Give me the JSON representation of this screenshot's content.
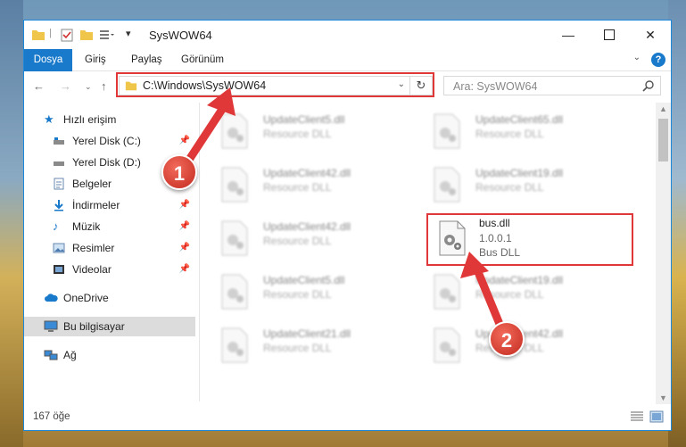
{
  "window": {
    "title": "SysWOW64"
  },
  "ribbon": {
    "tabs": [
      "Dosya",
      "Giriş",
      "Paylaş",
      "Görünüm"
    ],
    "help": "?"
  },
  "address": {
    "path": "C:\\Windows\\SysWOW64"
  },
  "search": {
    "placeholder": "Ara: SysWOW64"
  },
  "sidebar": {
    "quick_access": "Hızlı erişim",
    "items": [
      {
        "label": "Yerel Disk (C:)",
        "icon": "drive-icon"
      },
      {
        "label": "Yerel Disk (D:)",
        "icon": "drive-icon"
      },
      {
        "label": "Belgeler",
        "icon": "documents-icon"
      },
      {
        "label": "İndirmeler",
        "icon": "download-icon"
      },
      {
        "label": "Müzik",
        "icon": "music-icon"
      },
      {
        "label": "Resimler",
        "icon": "pictures-icon"
      },
      {
        "label": "Videolar",
        "icon": "video-icon"
      }
    ],
    "onedrive": "OneDrive",
    "this_pc": "Bu bilgisayar",
    "network": "Ağ"
  },
  "files": {
    "left": [
      {
        "name": "UpdateClient5.dll",
        "desc": "Resource DLL"
      },
      {
        "name": "UpdateClient42.dll",
        "desc": "Resource DLL"
      },
      {
        "name": "UpdateClient42.dll",
        "desc": "Resource DLL"
      },
      {
        "name": "UpdateClient5.dll",
        "desc": "Resource DLL"
      },
      {
        "name": "UpdateClient21.dll",
        "desc": "Resource DLL"
      }
    ],
    "right": [
      {
        "name": "UpdateClient65.dll",
        "desc": "Resource DLL"
      },
      {
        "name": "UpdateClient19.dll",
        "desc": "Resource DLL"
      },
      {
        "name": "UpdateClient19.dll",
        "desc": "Resource DLL"
      },
      {
        "name": "UpdateClient42.dll",
        "desc": "Resource DLL"
      }
    ],
    "highlight": {
      "name": "bus.dll",
      "version": "1.0.0.1",
      "desc": "Bus DLL"
    }
  },
  "status": {
    "count": "167 öğe"
  },
  "annotations": {
    "step1": "1",
    "step2": "2"
  },
  "colors": {
    "accent": "#1979ca",
    "highlight_red": "#e03838"
  }
}
